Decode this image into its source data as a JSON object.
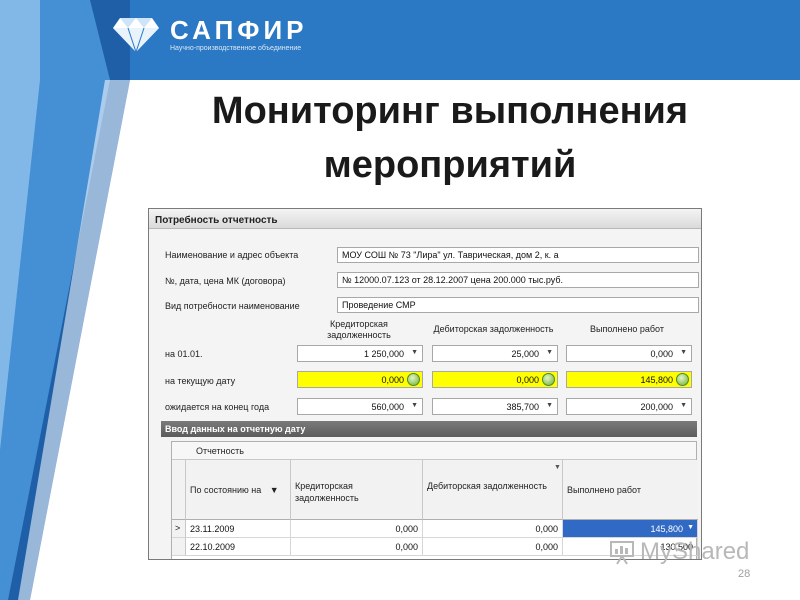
{
  "slide": {
    "logo": {
      "name": "САПФИР",
      "subtitle": "Научно-производственное объединение"
    },
    "title": "Мониторинг выполнения мероприятий",
    "page_number": "28",
    "watermark": "MyShared"
  },
  "window": {
    "title": "Потребность отчетность",
    "form": {
      "object_label": "Наименование и адрес объекта",
      "object_value": "МОУ СОШ № 73 \"Лира\" ул. Таврическая, дом 2, к. а",
      "contract_label": "№, дата, цена МК (договора)",
      "contract_value": "№ 12000.07.123 от 28.12.2007 цена 200.000 тыс.руб.",
      "kind_label": "Вид потребности наименование",
      "kind_value": "Проведение СМР"
    },
    "summary": {
      "columns": [
        "Кредиторская задолженность",
        "Дебиторская задолженность",
        "Выполнено работ"
      ],
      "rows": [
        {
          "label": "на 01.01.",
          "values": [
            "1 250,000",
            "25,000",
            "0,000"
          ]
        },
        {
          "label": "на текущую дату",
          "values": [
            "0,000",
            "0,000",
            "145,800"
          ]
        },
        {
          "label": "ожидается на конец года",
          "values": [
            "560,000",
            "385,700",
            "200,000"
          ]
        }
      ]
    },
    "input_section": {
      "title": "Ввод данных на отчетную дату",
      "group": "Отчетность",
      "columns": [
        "По состоянию на",
        "Кредиторская задолженность",
        "Дебиторская задолженность",
        "Выполнено работ"
      ],
      "sort_icon": "▼",
      "rows": [
        {
          "marker": ">",
          "date": "23.11.2009",
          "cred": "0,000",
          "deb": "0,000",
          "done": "145,800"
        },
        {
          "marker": "",
          "date": "22.10.2009",
          "cred": "0,000",
          "deb": "0,000",
          "done": "130,500"
        }
      ]
    }
  },
  "colors": {
    "brand_blue": "#2b78c4",
    "highlight_yellow": "#ffff00",
    "selection": "#316ac5"
  }
}
